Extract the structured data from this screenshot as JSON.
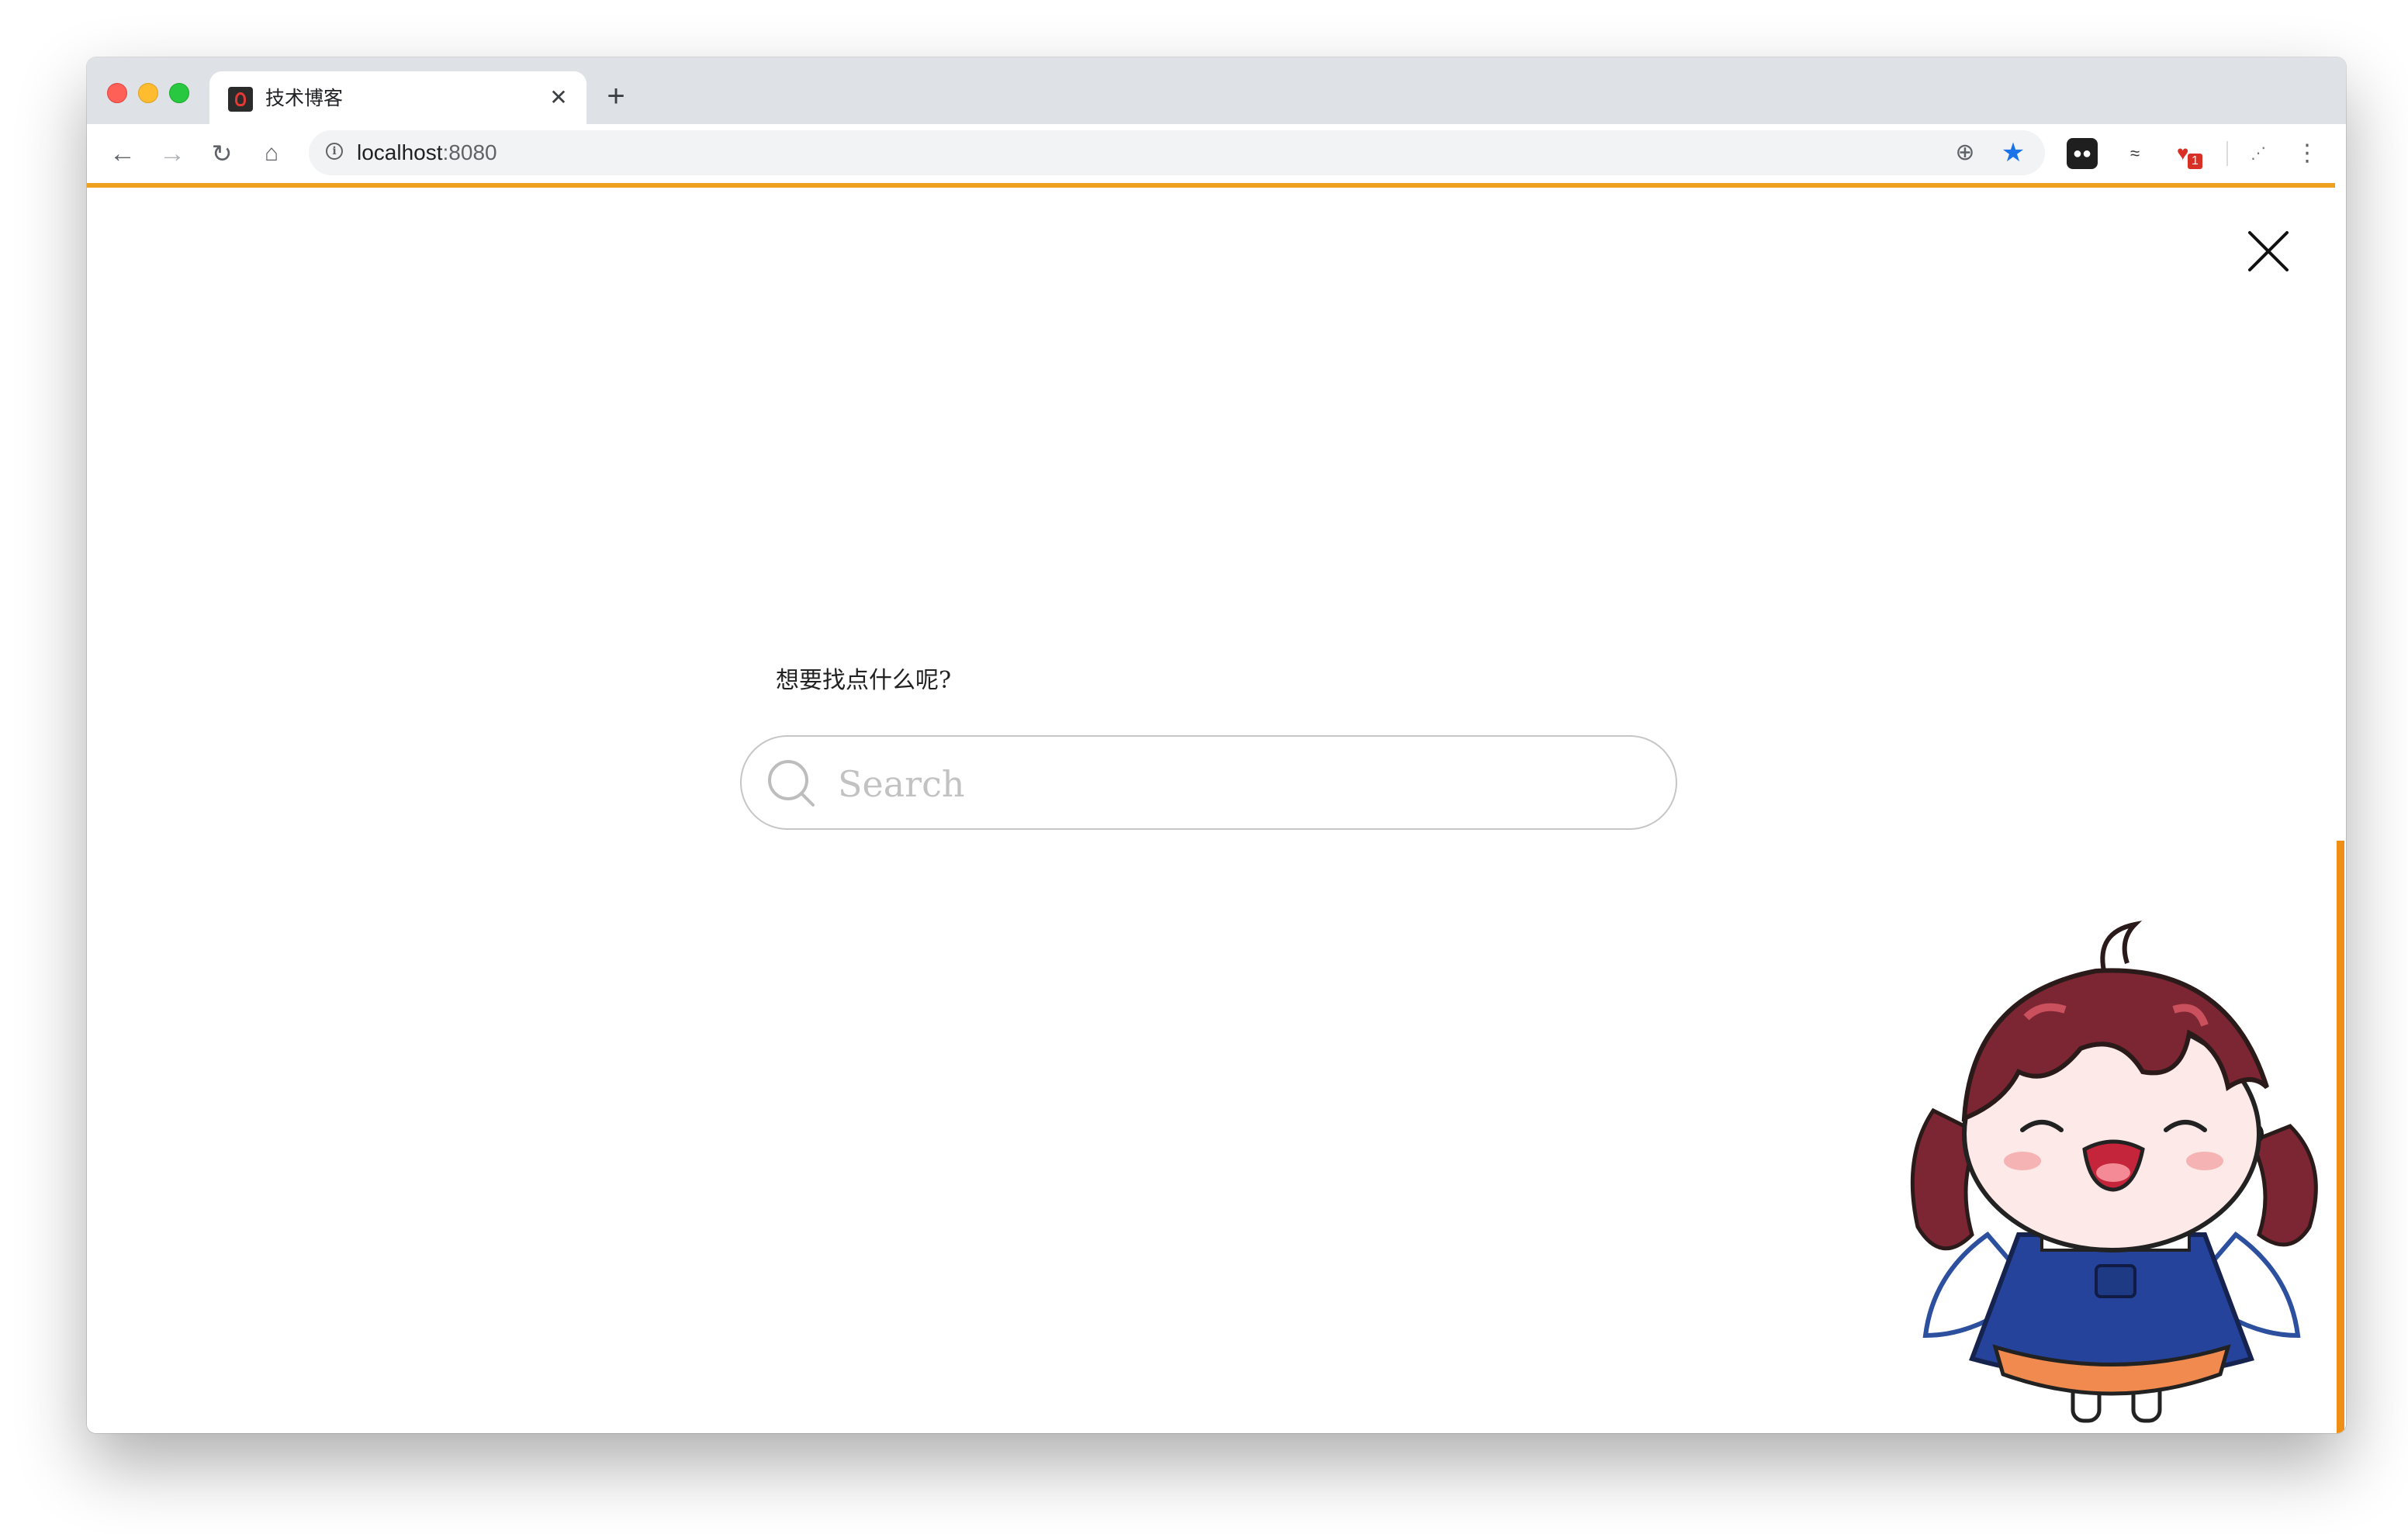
{
  "browser": {
    "tab": {
      "title": "技术博客",
      "close_glyph": "✕"
    },
    "new_tab_glyph": "+",
    "nav": {
      "back": "←",
      "forward": "→",
      "reload": "↻",
      "home": "⌂"
    },
    "address": {
      "host": "localhost",
      "port": ":8080"
    },
    "omnibox_icons": {
      "add": "⊕",
      "star": "★"
    },
    "extensions": {
      "ext1": "●●",
      "ext2": "≈",
      "ext3_badge": "1",
      "ext4": "⋰"
    },
    "menu_glyph": "⋮"
  },
  "search_overlay": {
    "prompt": "想要找点什么呢?",
    "placeholder": "Search"
  },
  "colors": {
    "accent": "#f0a020",
    "scrollbar": "#ef8f15",
    "star": "#1a73e8",
    "tabstrip": "#dee1e6"
  },
  "icons": [
    "favicon-icon",
    "close-icon",
    "search-icon",
    "star-icon",
    "info-icon",
    "mascot-image"
  ]
}
